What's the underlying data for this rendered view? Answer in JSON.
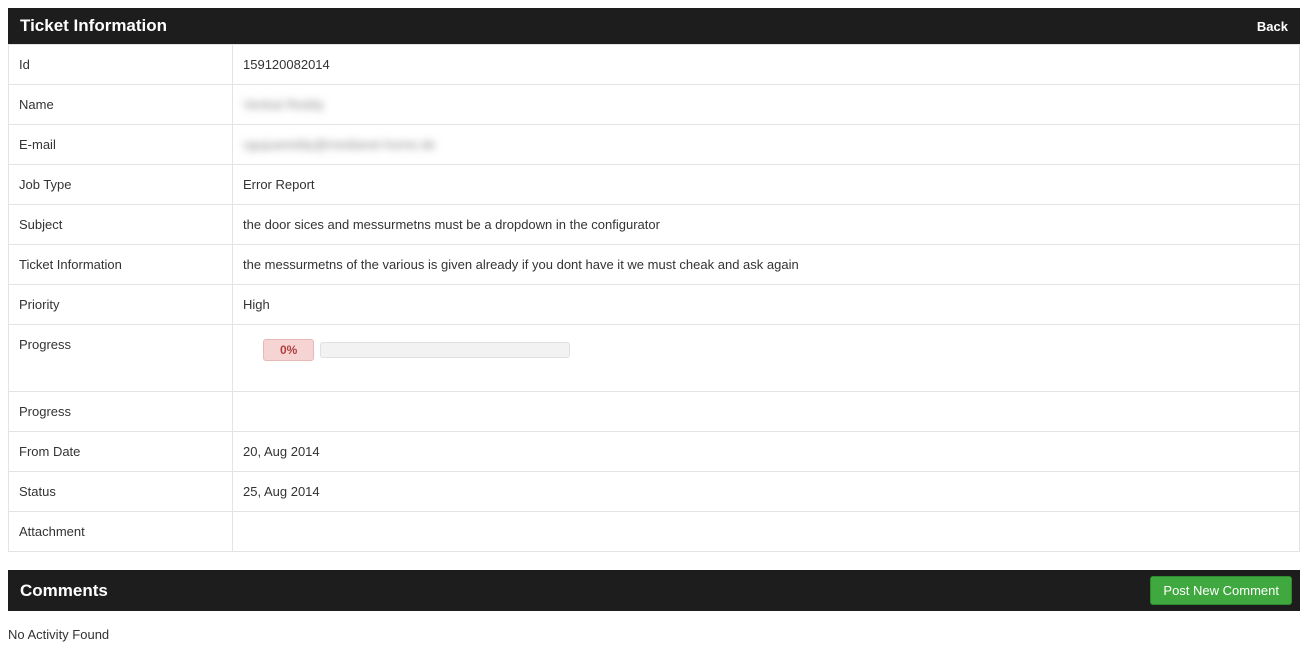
{
  "header": {
    "title": "Ticket Information",
    "back_label": "Back"
  },
  "fields": {
    "id": {
      "label": "Id",
      "value": "159120082014"
    },
    "name": {
      "label": "Name",
      "value": "Venkat Reddy"
    },
    "email": {
      "label": "E-mail",
      "value": "vgujuareddy@medianet-home.de"
    },
    "jobtype": {
      "label": "Job Type",
      "value": "Error Report"
    },
    "subject": {
      "label": "Subject",
      "value": "the door sices and messurmetns must be a dropdown in the configurator"
    },
    "ticketinfo": {
      "label": "Ticket Information",
      "value": "the messurmetns of the various is given already if you dont have it we must cheak and ask again"
    },
    "priority": {
      "label": "Priority",
      "value": "High"
    },
    "progress": {
      "label": "Progress",
      "percent_text": "0%"
    },
    "progress2": {
      "label": "Progress",
      "value": ""
    },
    "fromdate": {
      "label": "From Date",
      "value": "20, Aug 2014"
    },
    "status": {
      "label": "Status",
      "value": "25, Aug 2014"
    },
    "attachment": {
      "label": "Attachment",
      "value": ""
    }
  },
  "comments": {
    "title": "Comments",
    "button_label": "Post New Comment",
    "empty_text": "No Activity Found"
  }
}
